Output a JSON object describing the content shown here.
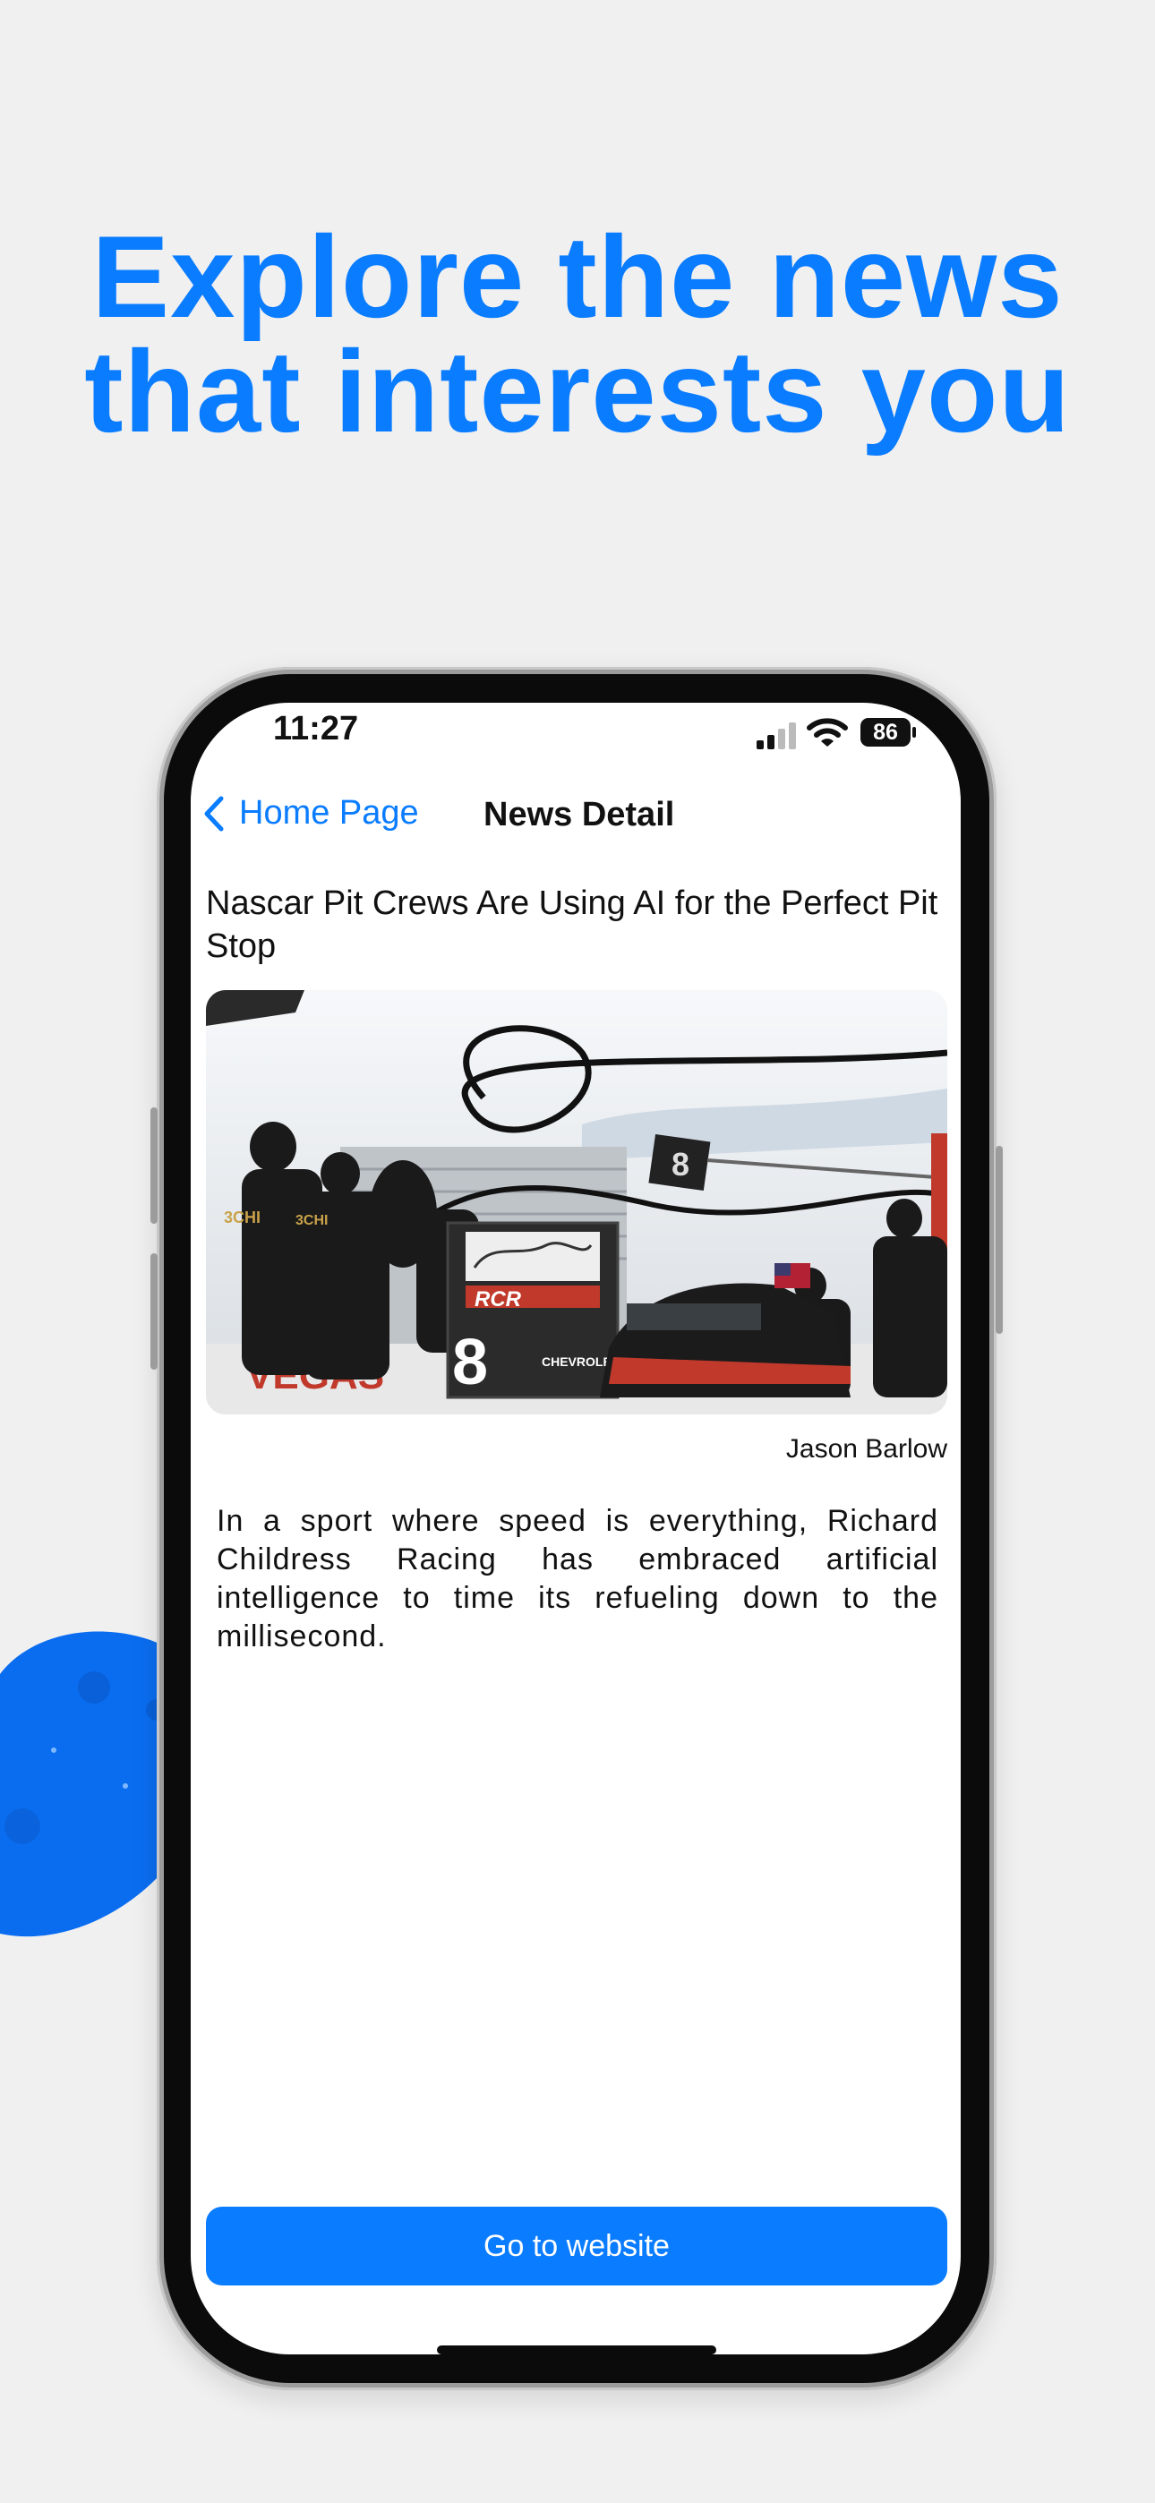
{
  "headline": {
    "line1": "Explore the news",
    "line2": "that interests you"
  },
  "status_bar": {
    "time": "11:27",
    "battery": "86"
  },
  "nav": {
    "back_label": "Home Page",
    "title": "News Detail"
  },
  "article": {
    "title": "Nascar Pit Crews Are Using AI for the Perfect Pit Stop",
    "author": "Jason Barlow",
    "summary": "In a sport where speed is everything, Richard Childress Racing has embraced artificial intelligence to time its refueling down to the millisecond.",
    "image_texts": {
      "crew_logo": "3CHI",
      "car_number": "8",
      "sponsor": "RCR",
      "brand": "CHEVROLET",
      "wall": "VEGAS"
    }
  },
  "cta": {
    "label": "Go to website"
  },
  "colors": {
    "accent": "#0a7cff",
    "background": "#f0f0f0"
  },
  "icons": [
    "chevron-left-icon",
    "cellular-signal-icon",
    "wifi-icon",
    "battery-icon"
  ]
}
